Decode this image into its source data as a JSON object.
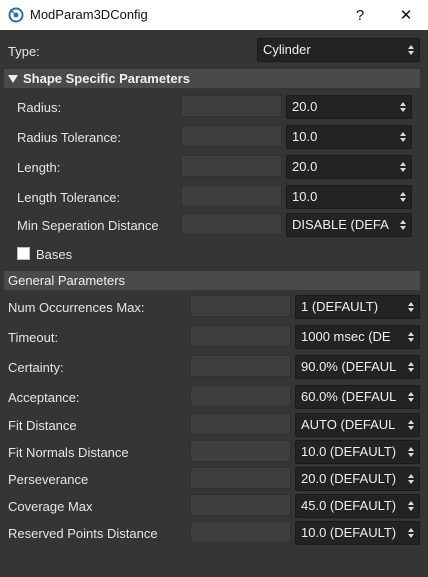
{
  "window": {
    "title": "ModParam3DConfig",
    "help_label": "?",
    "close_label": "✕",
    "icon": "app-icon"
  },
  "type": {
    "label": "Type:",
    "value": "Cylinder"
  },
  "shape_section": {
    "title": "Shape Specific Parameters",
    "rows": [
      {
        "label": "Radius:",
        "value": "20.0"
      },
      {
        "label": "Radius Tolerance:",
        "value": "10.0"
      },
      {
        "label": "Length:",
        "value": "20.0"
      },
      {
        "label": "Length Tolerance:",
        "value": "10.0"
      },
      {
        "label": "Min Seperation Distance",
        "value": "DISABLE (DEFA"
      }
    ],
    "bases": {
      "label": "Bases",
      "checked": false
    }
  },
  "general_section": {
    "title": "General Parameters",
    "rows": [
      {
        "label": "Num Occurrences Max:",
        "value": "1 (DEFAULT)"
      },
      {
        "label": "Timeout:",
        "value": "1000 msec (DE"
      },
      {
        "label": "Certainty:",
        "value": "90.0% (DEFAUL"
      },
      {
        "label": "Acceptance:",
        "value": "60.0% (DEFAUL"
      },
      {
        "label": "Fit Distance",
        "value": "AUTO (DEFAUL"
      },
      {
        "label": "Fit Normals Distance",
        "value": "10.0 (DEFAULT)"
      },
      {
        "label": "Perseverance",
        "value": "20.0 (DEFAULT)"
      },
      {
        "label": "Coverage Max",
        "value": "45.0 (DEFAULT)"
      },
      {
        "label": "Reserved Points Distance",
        "value": "10.0 (DEFAULT)"
      }
    ]
  },
  "colors": {
    "background": "#353535",
    "header": "#4a4a4a",
    "combo": "#232323",
    "field": "#3e3e3e"
  }
}
